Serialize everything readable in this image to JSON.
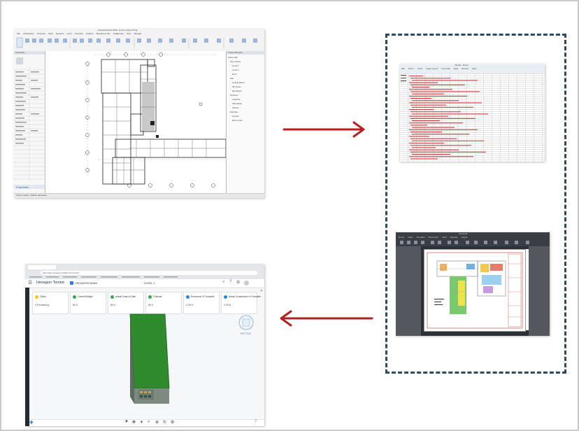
{
  "revit": {
    "title": "Autodesk Revit 2019 - [Level 1 Floor Plan]",
    "ribbon_tabs": [
      "File",
      "Architecture",
      "Structure",
      "Steel",
      "Systems",
      "Insert",
      "Annotate",
      "Analyze",
      "Massing & Site",
      "Collaborate",
      "View",
      "Manage"
    ],
    "properties_title": "Properties",
    "browser_title": "Project Browser",
    "browser_items": [
      "Views (all)",
      "Floor Plans",
      "Level 1",
      "Level 2",
      "Roof",
      "Site",
      "Ceiling Plans",
      "3D Views",
      "Elevations",
      "Sections",
      "Legends",
      "Schedules",
      "Sheets",
      "Families",
      "Groups",
      "Revit Links"
    ],
    "status": "Click to select, TAB for alternates"
  },
  "excel": {
    "title": "Book1 - Excel",
    "menu": [
      "File",
      "Home",
      "Insert",
      "Page Layout",
      "Formulas",
      "Data",
      "Review",
      "View"
    ]
  },
  "cad": {
    "title": "AutoCAD",
    "tabs": [
      "Home",
      "Insert",
      "Annotate",
      "Parametric",
      "View",
      "Manage",
      "Output"
    ]
  },
  "webapp": {
    "url": "https://app.hexagon-facility.com/model/...",
    "app_name": "Hexagon Tenant",
    "model_name": "HEXAGON MAIN",
    "level_select": "LEVEL 1",
    "cards": [
      {
        "label": "Floors",
        "value": "0 Remaining",
        "color": "#f5c518"
      },
      {
        "label": "Current Budget",
        "value": "$0.0",
        "color": "#3aa655"
      },
      {
        "label": "Actual Costs to Date",
        "value": "$0.0",
        "color": "#3aa655"
      },
      {
        "label": "Forecast",
        "value": "$0.0",
        "color": "#3aa655"
      },
      {
        "label": "Resources % Complete",
        "value": "0.00%",
        "color": "#1e88e5"
      },
      {
        "label": "Actual Construction % Complete",
        "value": "0.00%",
        "color": "#1e88e5"
      }
    ],
    "cube_face": "BOTTOM"
  },
  "colors": {
    "arrow": "#b51f1f",
    "dash_border": "#2d4a63",
    "model_green": "#2e8b2e"
  }
}
